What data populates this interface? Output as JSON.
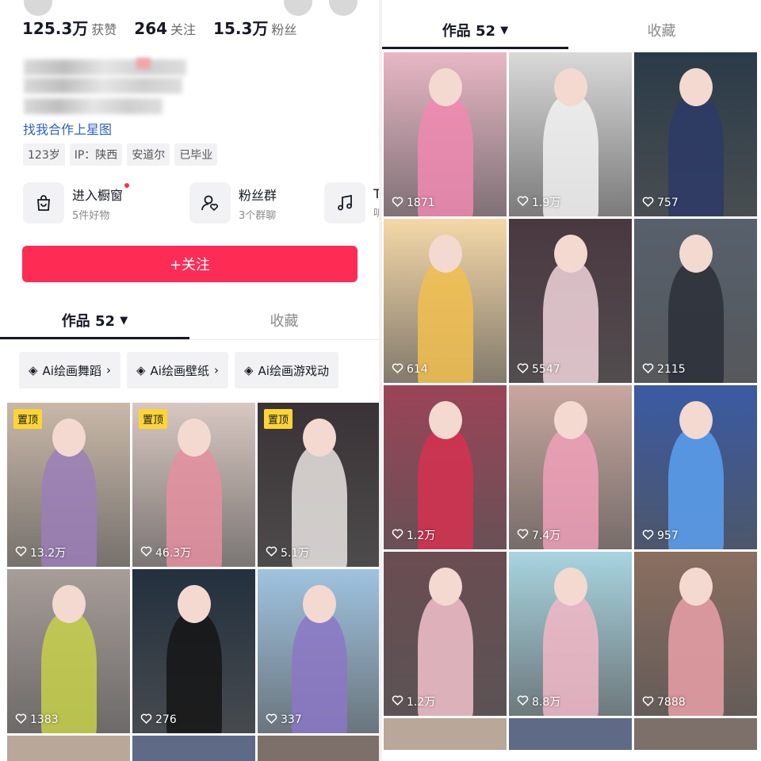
{
  "profile": {
    "stats": [
      {
        "num": "125.3万",
        "label": "获赞"
      },
      {
        "num": "264",
        "label": "关注"
      },
      {
        "num": "15.3万",
        "label": "粉丝"
      }
    ],
    "bio_link": "找我合作上星图",
    "tags": [
      "123岁",
      "IP：陕西",
      "安道尔",
      "已毕业"
    ],
    "shortcuts": [
      {
        "title": "进入橱窗",
        "sub": "5件好物",
        "icon": "shopping-bag-icon"
      },
      {
        "title": "粉丝群",
        "sub": "3个群聊",
        "icon": "fans-group-icon"
      },
      {
        "title": "Ta",
        "sub": "听",
        "icon": "music-note-icon"
      }
    ],
    "follow_label": "+关注"
  },
  "tabs": {
    "works": "作品 52",
    "favorites": "收藏"
  },
  "chips": [
    "Ai绘画舞蹈",
    "Ai绘画壁纸",
    "Ai绘画游戏动"
  ],
  "pin_label": "置顶",
  "left_grid": [
    {
      "likes": "13.2万",
      "pinned": true,
      "bg": "#c9b8a8",
      "fig": "#9b7fb8"
    },
    {
      "likes": "46.3万",
      "pinned": true,
      "bg": "#d8c7c1",
      "fig": "#e58fa0"
    },
    {
      "likes": "5.1万",
      "pinned": true,
      "bg": "#3a3236",
      "fig": "#e9e4e2"
    },
    {
      "likes": "1383",
      "pinned": false,
      "bg": "#a79d99",
      "fig": "#c7d04a"
    },
    {
      "likes": "276",
      "pinned": false,
      "bg": "#23303e",
      "fig": "#151515"
    },
    {
      "likes": "337",
      "pinned": false,
      "bg": "#9fc3e0",
      "fig": "#8c77c5"
    }
  ],
  "right_grid": [
    {
      "likes": "1871",
      "bg": "#e8b7c6",
      "fig": "#f08ab0"
    },
    {
      "likes": "1.9万",
      "bg": "#d9d9d9",
      "fig": "#f2f2f2"
    },
    {
      "likes": "757",
      "bg": "#2a3b48",
      "fig": "#2d3a66"
    },
    {
      "likes": "614",
      "bg": "#f5d8a8",
      "fig": "#f1c050"
    },
    {
      "likes": "5547",
      "bg": "#4a3840",
      "fig": "#f1d4dc"
    },
    {
      "likes": "2115",
      "bg": "#57606c",
      "fig": "#2a2f38"
    },
    {
      "likes": "1.2万",
      "bg": "#9b4458",
      "fig": "#d63150"
    },
    {
      "likes": "7.4万",
      "bg": "#c8a79f",
      "fig": "#f0a0b8"
    },
    {
      "likes": "957",
      "bg": "#3a5aa3",
      "fig": "#5aa0f0"
    },
    {
      "likes": "1.2万",
      "bg": "#6a4d52",
      "fig": "#f3c2cc"
    },
    {
      "likes": "8.8万",
      "bg": "#a8d4e0",
      "fig": "#f2b7c7"
    },
    {
      "likes": "7888",
      "bg": "#8a6e60",
      "fig": "#e9a0a8"
    }
  ],
  "colors": {
    "accent": "#fe2c55",
    "link": "#2b62c7",
    "pin": "#fcd535"
  }
}
